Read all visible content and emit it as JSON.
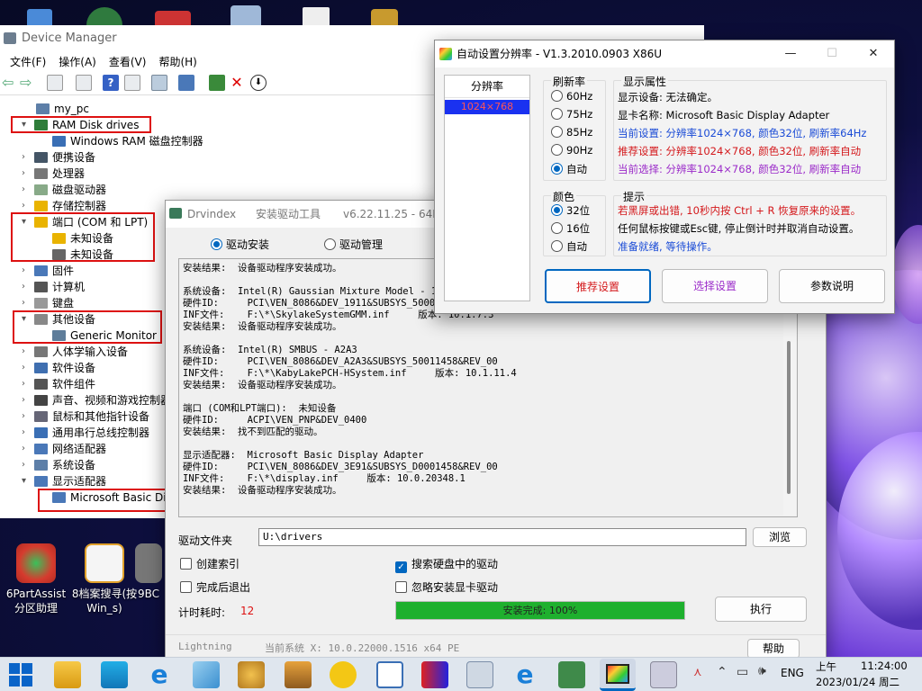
{
  "device_manager": {
    "title": "Device Manager",
    "menu": [
      "文件(F)",
      "操作(A)",
      "查看(V)",
      "帮助(H)"
    ],
    "tree": [
      {
        "label": "my_pc",
        "level": 0,
        "arrow": ""
      },
      {
        "label": "RAM Disk drives",
        "level": 1,
        "arrow": "▾"
      },
      {
        "label": "Windows RAM 磁盘控制器",
        "level": 2,
        "arrow": ""
      },
      {
        "label": "便携设备",
        "level": 1,
        "arrow": "›"
      },
      {
        "label": "处理器",
        "level": 1,
        "arrow": "›"
      },
      {
        "label": "磁盘驱动器",
        "level": 1,
        "arrow": "›"
      },
      {
        "label": "存储控制器",
        "level": 1,
        "arrow": "›"
      },
      {
        "label": "端口 (COM 和 LPT)",
        "level": 1,
        "arrow": "▾"
      },
      {
        "label": "未知设备",
        "level": 2,
        "arrow": ""
      },
      {
        "label": "未知设备",
        "level": 2,
        "arrow": ""
      },
      {
        "label": "固件",
        "level": 1,
        "arrow": "›"
      },
      {
        "label": "计算机",
        "level": 1,
        "arrow": "›"
      },
      {
        "label": "键盘",
        "level": 1,
        "arrow": "›"
      },
      {
        "label": "其他设备",
        "level": 1,
        "arrow": "▾"
      },
      {
        "label": "Generic Monitor",
        "level": 2,
        "arrow": ""
      },
      {
        "label": "人体学输入设备",
        "level": 1,
        "arrow": "›"
      },
      {
        "label": "软件设备",
        "level": 1,
        "arrow": "›"
      },
      {
        "label": "软件组件",
        "level": 1,
        "arrow": "›"
      },
      {
        "label": "声音、视频和游戏控制器",
        "level": 1,
        "arrow": "›"
      },
      {
        "label": "鼠标和其他指针设备",
        "level": 1,
        "arrow": "›"
      },
      {
        "label": "通用串行总线控制器",
        "level": 1,
        "arrow": "›"
      },
      {
        "label": "网络适配器",
        "level": 1,
        "arrow": "›"
      },
      {
        "label": "系统设备",
        "level": 1,
        "arrow": "›"
      },
      {
        "label": "显示适配器",
        "level": 1,
        "arrow": "▾"
      },
      {
        "label": "Microsoft Basic Di",
        "level": 2,
        "arrow": ""
      }
    ]
  },
  "drvindex": {
    "title": "Drvindex",
    "subtitle": "安装驱动工具",
    "version": "v6.22.11.25 - 64B",
    "tabs": [
      "驱动安装",
      "驱动管理"
    ],
    "log": "安装结果:  设备驱动程序安装成功。\n\n系统设备:  Intel(R) Gaussian Mixture Model - 1\n硬件ID:     PCI\\VEN_8086&DEV_1911&SUBSYS_5000145\nINF文件:    F:\\*\\SkylakeSystemGMM.inf     版本: 10.1.7.3\n安装结果:  设备驱动程序安装成功。\n\n系统设备:  Intel(R) SMBUS - A2A3\n硬件ID:     PCI\\VEN_8086&DEV_A2A3&SUBSYS_50011458&REV_00\nINF文件:    F:\\*\\KabyLakePCH-HSystem.inf     版本: 10.1.11.4\n安装结果:  设备驱动程序安装成功。\n\n端口 (COM和LPT端口):  未知设备\n硬件ID:     ACPI\\VEN_PNP&DEV_0400\n安装结果:  找不到匹配的驱动。\n\n显示适配器:  Microsoft Basic Display Adapter\n硬件ID:     PCI\\VEN_8086&DEV_3E91&SUBSYS_D0001458&REV_00\nINF文件:    F:\\*\\display.inf     版本: 10.0.20348.1\n安装结果:  设备驱动程序安装成功。",
    "folder_label": "驱动文件夹",
    "folder_value": "U:\\drivers",
    "browse": "浏览",
    "cb_index": "创建索引",
    "cb_search": "搜索硬盘中的驱动",
    "cb_exit": "完成后退出",
    "cb_ignore": "忽略安装显卡驱动",
    "timer_label": "计时耗时:",
    "timer_value": "12",
    "progress_text": "安装完成: 100%",
    "progress": 1.0,
    "execute": "执行",
    "status_brand": "Lightning",
    "status_sys": "当前系统 X: 10.0.22000.1516 x64  PE",
    "help": "帮助"
  },
  "res": {
    "title": "自动设置分辨率 - V1.3.2010.0903 X86U",
    "list_header": "分辨率",
    "list_item": "1024×768",
    "refresh_group": "刷新率",
    "refresh": [
      "60Hz",
      "75Hz",
      "85Hz",
      "90Hz",
      "自动"
    ],
    "color_group": "颜色",
    "colors": [
      "32位",
      "16位",
      "自动"
    ],
    "display_group": "显示属性",
    "disp_line1": "显示设备: 无法确定。",
    "disp_line2": "显卡名称: Microsoft Basic Display Adapter",
    "disp_line3": "当前设置: 分辨率1024×768, 颜色32位, 刷新率64Hz",
    "disp_line4": "推荐设置: 分辨率1024×768, 颜色32位, 刷新率自动",
    "disp_line5": "当前选择: 分辨率1024×768, 颜色32位, 刷新率自动",
    "tips_group": "提示",
    "tip1": "若黑屏或出错, 10秒内按 Ctrl + R 恢复原来的设置。",
    "tip2": "任何鼠标按键或Esc键, 停止倒计时并取消自动设置。",
    "tip3": "准备就绪, 等待操作。",
    "btn_recommend": "推荐设置",
    "btn_select": "选择设置",
    "btn_help": "参数说明"
  },
  "desktop": [
    {
      "label": "6PartAssist\n分区助理"
    },
    {
      "label": "8档案搜寻(按\nWin_s)"
    },
    {
      "label": "9BC"
    }
  ],
  "taskbar": {
    "lang": "ENG",
    "ampm": "上午",
    "time": "11:24:00",
    "date": "2023/01/24 周二"
  },
  "colors": {
    "accent": "#0067c0",
    "progress": "#1eb02e",
    "current": "#1a4bd6",
    "recommend": "#d4191c",
    "select": "#9b2bc9"
  }
}
